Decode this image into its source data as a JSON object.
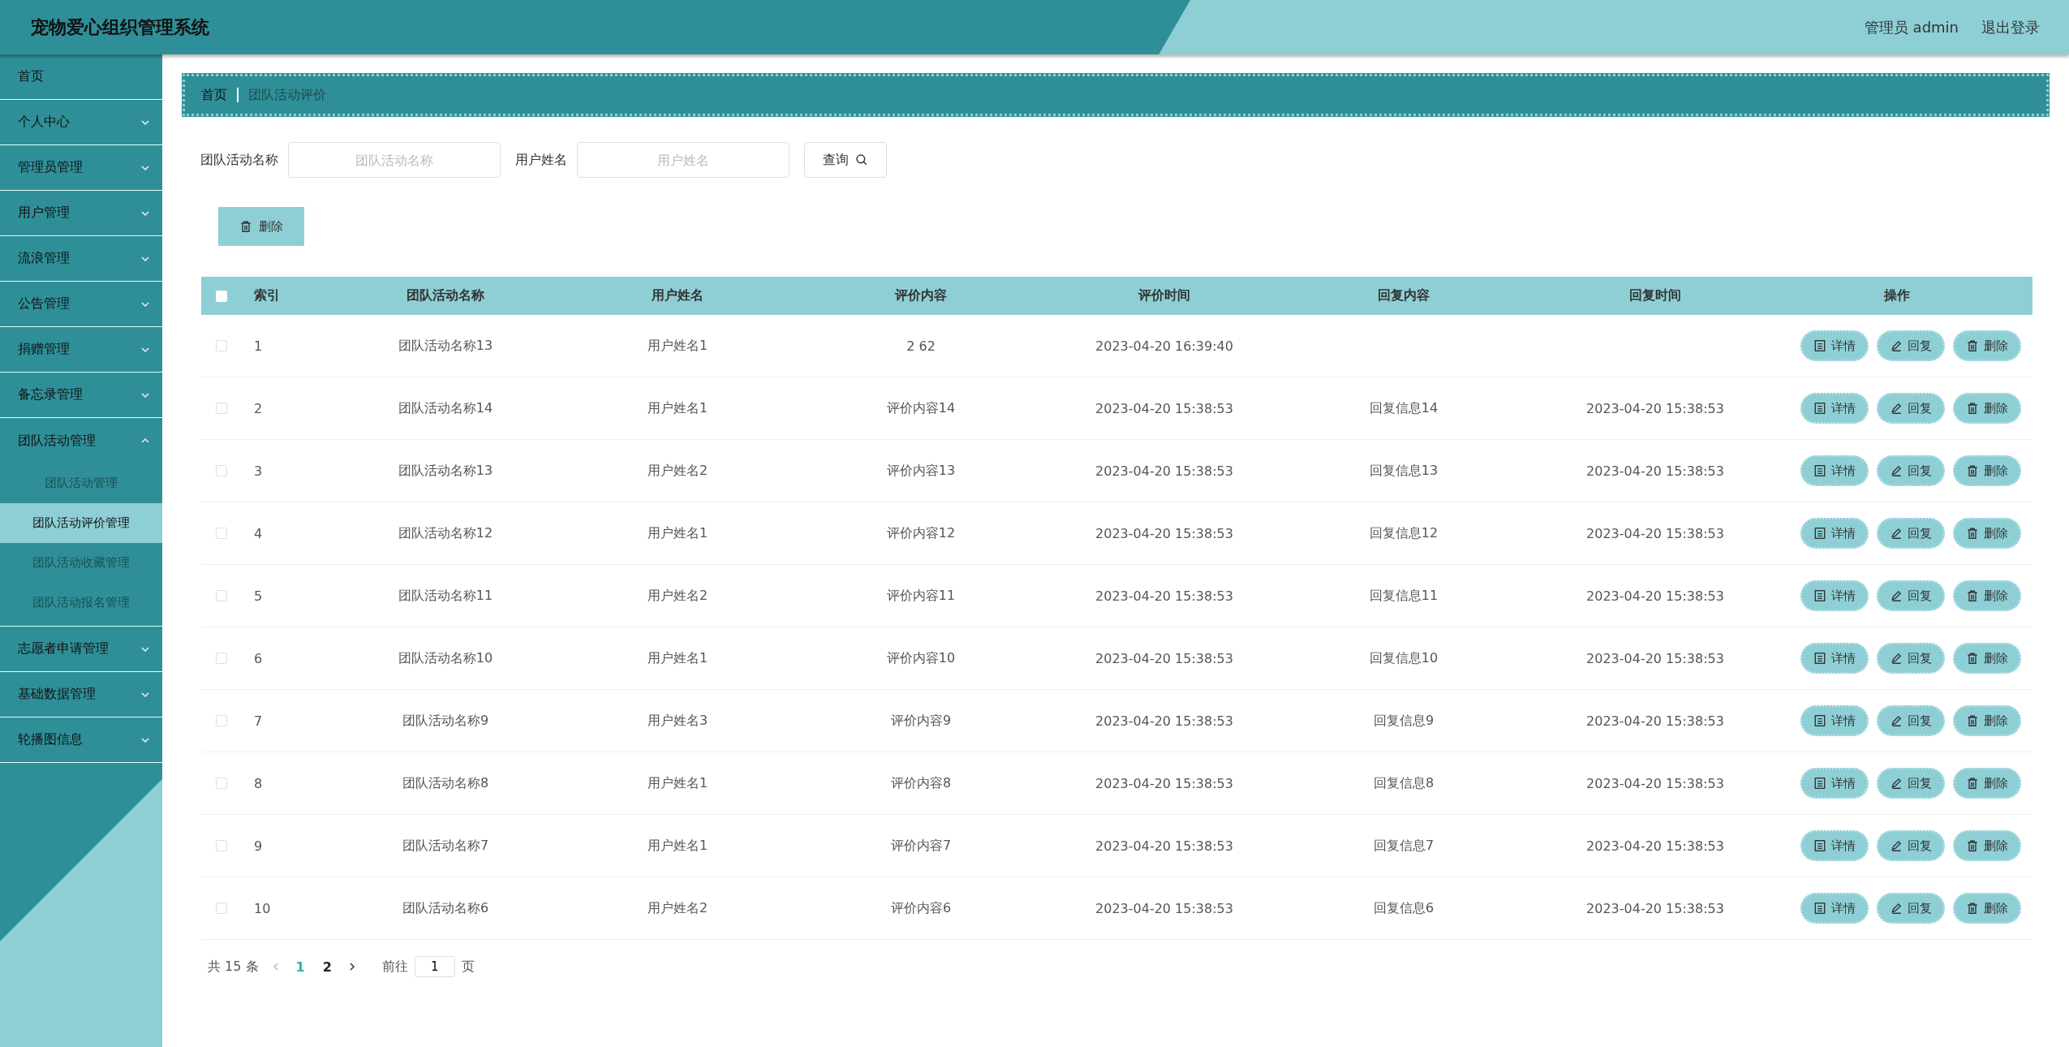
{
  "header": {
    "title": "宠物爱心组织管理系统",
    "user": "管理员 admin",
    "logout": "退出登录"
  },
  "sidebar": {
    "items": [
      {
        "label": "首页",
        "kind": "link",
        "expanded": false
      },
      {
        "label": "个人中心",
        "kind": "menu",
        "expanded": false
      },
      {
        "label": "管理员管理",
        "kind": "menu",
        "expanded": false
      },
      {
        "label": "用户管理",
        "kind": "menu",
        "expanded": false
      },
      {
        "label": "流浪管理",
        "kind": "menu",
        "expanded": false
      },
      {
        "label": "公告管理",
        "kind": "menu",
        "expanded": false
      },
      {
        "label": "捐赠管理",
        "kind": "menu",
        "expanded": false
      },
      {
        "label": "备忘录管理",
        "kind": "menu",
        "expanded": false
      },
      {
        "label": "团队活动管理",
        "kind": "menu",
        "expanded": true,
        "children": [
          {
            "label": "团队活动管理",
            "selected": false
          },
          {
            "label": "团队活动评价管理",
            "selected": true
          },
          {
            "label": "团队活动收藏管理",
            "selected": false
          },
          {
            "label": "团队活动报名管理",
            "selected": false
          }
        ]
      },
      {
        "label": "志愿者申请管理",
        "kind": "menu",
        "expanded": false
      },
      {
        "label": "基础数据管理",
        "kind": "menu",
        "expanded": false
      },
      {
        "label": "轮播图信息",
        "kind": "menu",
        "expanded": false
      }
    ]
  },
  "breadcrumb": [
    "首页",
    "团队活动评价"
  ],
  "search": {
    "fields": [
      {
        "label": "团队活动名称",
        "placeholder": "团队活动名称"
      },
      {
        "label": "用户姓名",
        "placeholder": "用户姓名"
      }
    ],
    "button": "查询"
  },
  "toolbar": {
    "delete": "删除"
  },
  "table": {
    "all_selected": false,
    "columns": [
      "索引",
      "团队活动名称",
      "用户姓名",
      "评价内容",
      "评价时间",
      "回复内容",
      "回复时间",
      "操作"
    ],
    "rows": [
      {
        "selected": false,
        "index": "1",
        "activity": "团队活动名称13",
        "user": "用户姓名1",
        "content": "2 62",
        "time": "2023-04-20 16:39:40",
        "actions": [
          "详情",
          "回复",
          "删除"
        ]
      },
      {
        "selected": false,
        "index": "2",
        "activity": "团队活动名称14",
        "user": "用户姓名1",
        "content": "评价内容14",
        "time": "2023-04-20 15:38:53",
        "reply": "回复信息14",
        "reply_time": "2023-04-20 15:38:53",
        "actions": [
          "详情",
          "回复",
          "删除"
        ]
      },
      {
        "selected": false,
        "index": "3",
        "activity": "团队活动名称13",
        "user": "用户姓名2",
        "content": "评价内容13",
        "time": "2023-04-20 15:38:53",
        "reply": "回复信息13",
        "reply_time": "2023-04-20 15:38:53",
        "actions": [
          "详情",
          "回复",
          "删除"
        ]
      },
      {
        "selected": false,
        "index": "4",
        "activity": "团队活动名称12",
        "user": "用户姓名1",
        "content": "评价内容12",
        "time": "2023-04-20 15:38:53",
        "reply": "回复信息12",
        "reply_time": "2023-04-20 15:38:53",
        "actions": [
          "详情",
          "回复",
          "删除"
        ]
      },
      {
        "selected": false,
        "index": "5",
        "activity": "团队活动名称11",
        "user": "用户姓名2",
        "content": "评价内容11",
        "time": "2023-04-20 15:38:53",
        "reply": "回复信息11",
        "reply_time": "2023-04-20 15:38:53",
        "actions": [
          "详情",
          "回复",
          "删除"
        ]
      },
      {
        "selected": false,
        "index": "6",
        "activity": "团队活动名称10",
        "user": "用户姓名1",
        "content": "评价内容10",
        "time": "2023-04-20 15:38:53",
        "reply": "回复信息10",
        "reply_time": "2023-04-20 15:38:53",
        "actions": [
          "详情",
          "回复",
          "删除"
        ]
      },
      {
        "selected": false,
        "index": "7",
        "activity": "团队活动名称9",
        "user": "用户姓名3",
        "content": "评价内容9",
        "time": "2023-04-20 15:38:53",
        "reply": "回复信息9",
        "reply_time": "2023-04-20 15:38:53",
        "actions": [
          "详情",
          "回复",
          "删除"
        ]
      },
      {
        "selected": false,
        "index": "8",
        "activity": "团队活动名称8",
        "user": "用户姓名1",
        "content": "评价内容8",
        "time": "2023-04-20 15:38:53",
        "reply": "回复信息8",
        "reply_time": "2023-04-20 15:38:53",
        "actions": [
          "详情",
          "回复",
          "删除"
        ]
      },
      {
        "selected": false,
        "index": "9",
        "activity": "团队活动名称7",
        "user": "用户姓名1",
        "content": "评价内容7",
        "time": "2023-04-20 15:38:53",
        "reply": "回复信息7",
        "reply_time": "2023-04-20 15:38:53",
        "actions": [
          "详情",
          "回复",
          "删除"
        ]
      },
      {
        "selected": false,
        "index": "10",
        "activity": "团队活动名称6",
        "user": "用户姓名2",
        "content": "评价内容6",
        "time": "2023-04-20 15:38:53",
        "reply": "回复信息6",
        "reply_time": "2023-04-20 15:38:53",
        "actions": [
          "详情",
          "回复",
          "删除"
        ]
      }
    ]
  },
  "pagination": {
    "total": "共 15 条",
    "prev_disabled": true,
    "pages": [
      {
        "label": "1",
        "selected": true
      },
      {
        "label": "2",
        "selected": false
      }
    ],
    "goto": "前往",
    "page_value": "1",
    "page_unit": "页"
  }
}
